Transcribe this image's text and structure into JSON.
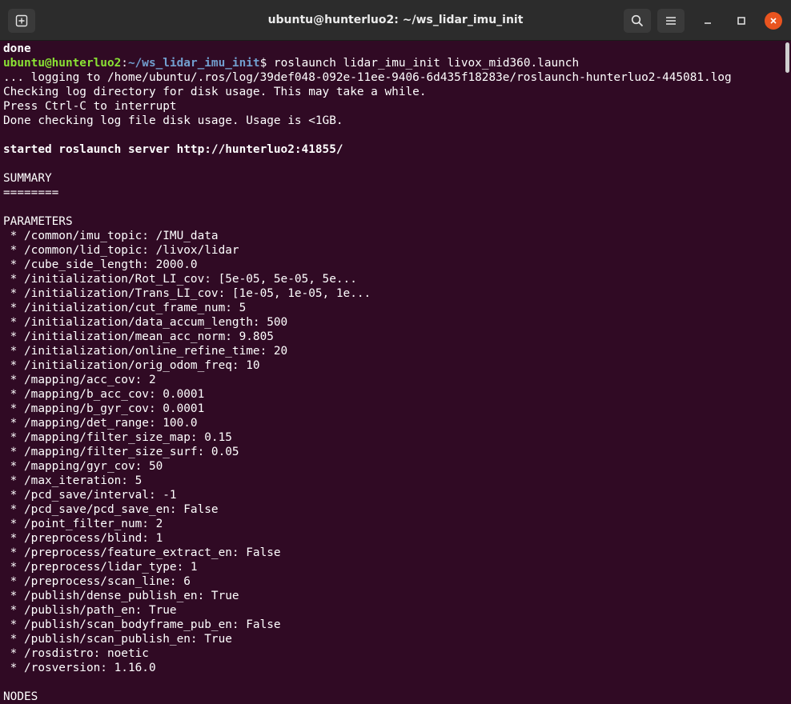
{
  "window": {
    "title": "ubuntu@hunterluo2: ~/ws_lidar_imu_init",
    "new_tab_icon": "new-tab-icon",
    "search_icon": "search-icon",
    "menu_icon": "hamburger-menu-icon",
    "minimize_icon": "minimize-icon",
    "maximize_icon": "maximize-icon",
    "close_icon": "close-icon"
  },
  "colors": {
    "background": "#300a24",
    "prompt_user": "#8ae234",
    "prompt_path": "#729fcf",
    "close_button": "#e9541f"
  },
  "terminal": {
    "line_0": "done",
    "prompt": {
      "user": "ubuntu@hunterluo2",
      "colon": ":",
      "path": "~/ws_lidar_imu_init",
      "command": "$ roslaunch lidar_imu_init livox_mid360.launch"
    },
    "line_2": "... logging to /home/ubuntu/.ros/log/39def048-092e-11ee-9406-6d435f18283e/roslaunch-hunterluo2-445081.log",
    "line_3": "Checking log directory for disk usage. This may take a while.",
    "line_4": "Press Ctrl-C to interrupt",
    "line_5": "Done checking log file disk usage. Usage is <1GB.",
    "line_7": "started roslaunch server http://hunterluo2:41855/",
    "line_9": "SUMMARY",
    "line_10": "========",
    "line_12": "PARAMETERS",
    "params": [
      " * /common/imu_topic: /IMU_data",
      " * /common/lid_topic: /livox/lidar",
      " * /cube_side_length: 2000.0",
      " * /initialization/Rot_LI_cov: [5e-05, 5e-05, 5e...",
      " * /initialization/Trans_LI_cov: [1e-05, 1e-05, 1e...",
      " * /initialization/cut_frame_num: 5",
      " * /initialization/data_accum_length: 500",
      " * /initialization/mean_acc_norm: 9.805",
      " * /initialization/online_refine_time: 20",
      " * /initialization/orig_odom_freq: 10",
      " * /mapping/acc_cov: 2",
      " * /mapping/b_acc_cov: 0.0001",
      " * /mapping/b_gyr_cov: 0.0001",
      " * /mapping/det_range: 100.0",
      " * /mapping/filter_size_map: 0.15",
      " * /mapping/filter_size_surf: 0.05",
      " * /mapping/gyr_cov: 50",
      " * /max_iteration: 5",
      " * /pcd_save/interval: -1",
      " * /pcd_save/pcd_save_en: False",
      " * /point_filter_num: 2",
      " * /preprocess/blind: 1",
      " * /preprocess/feature_extract_en: False",
      " * /preprocess/lidar_type: 1",
      " * /preprocess/scan_line: 6",
      " * /publish/dense_publish_en: True",
      " * /publish/path_en: True",
      " * /publish/scan_bodyframe_pub_en: False",
      " * /publish/scan_publish_en: True",
      " * /rosdistro: noetic",
      " * /rosversion: 1.16.0"
    ],
    "line_last": "NODES"
  }
}
